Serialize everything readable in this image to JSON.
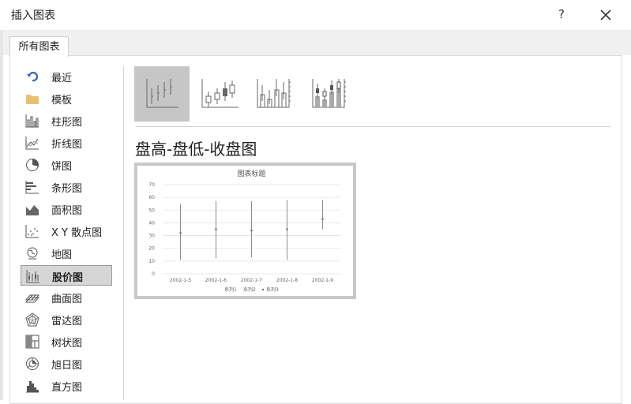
{
  "dialog": {
    "title": "插入图表",
    "help": "?",
    "close": "close"
  },
  "tabs": [
    {
      "label": "所有图表",
      "active": true
    }
  ],
  "sidebar": {
    "items": [
      {
        "label": "最近",
        "icon": "recent-icon"
      },
      {
        "label": "模板",
        "icon": "folder-icon"
      },
      {
        "label": "柱形图",
        "icon": "column-chart-icon"
      },
      {
        "label": "折线图",
        "icon": "line-chart-icon"
      },
      {
        "label": "饼图",
        "icon": "pie-chart-icon"
      },
      {
        "label": "条形图",
        "icon": "bar-chart-icon"
      },
      {
        "label": "面积图",
        "icon": "area-chart-icon"
      },
      {
        "label": "X Y 散点图",
        "icon": "scatter-chart-icon"
      },
      {
        "label": "地图",
        "icon": "map-chart-icon"
      },
      {
        "label": "股价图",
        "icon": "stock-chart-icon",
        "selected": true
      },
      {
        "label": "曲面图",
        "icon": "surface-chart-icon"
      },
      {
        "label": "雷达图",
        "icon": "radar-chart-icon"
      },
      {
        "label": "树状图",
        "icon": "treemap-chart-icon"
      },
      {
        "label": "旭日图",
        "icon": "sunburst-chart-icon"
      },
      {
        "label": "直方图",
        "icon": "histogram-chart-icon"
      }
    ]
  },
  "main": {
    "subtypes": [
      {
        "icon": "high-low-close-icon",
        "selected": true
      },
      {
        "icon": "open-high-low-close-icon"
      },
      {
        "icon": "volume-high-low-close-icon"
      },
      {
        "icon": "volume-open-high-low-close-icon"
      }
    ],
    "chart_name": "盘高-盘低-收盘图"
  },
  "chart_data": {
    "type": "stock",
    "title": "图表标题",
    "categories": [
      "2002-1-5",
      "2002-1-6",
      "2002-1-7",
      "2002-1-8",
      "2002-1-9"
    ],
    "ylim": [
      0,
      70
    ],
    "yticks": [
      0,
      10,
      20,
      30,
      40,
      50,
      60,
      70
    ],
    "grid": true,
    "legend_position": "bottom",
    "legend": [
      "系列1",
      "系列2",
      "系列3"
    ],
    "series": [
      {
        "name": "系列1",
        "values": [
          55,
          57,
          57,
          58,
          58
        ]
      },
      {
        "name": "系列2",
        "values": [
          11,
          12,
          13,
          11,
          35
        ]
      },
      {
        "name": "系列3",
        "values": [
          32,
          35,
          34,
          35,
          43
        ]
      }
    ]
  },
  "colors": {
    "accent_selected": "#d6d6d6",
    "gridline": "#e3e3e3",
    "stock_line": "#8c8c8c"
  }
}
